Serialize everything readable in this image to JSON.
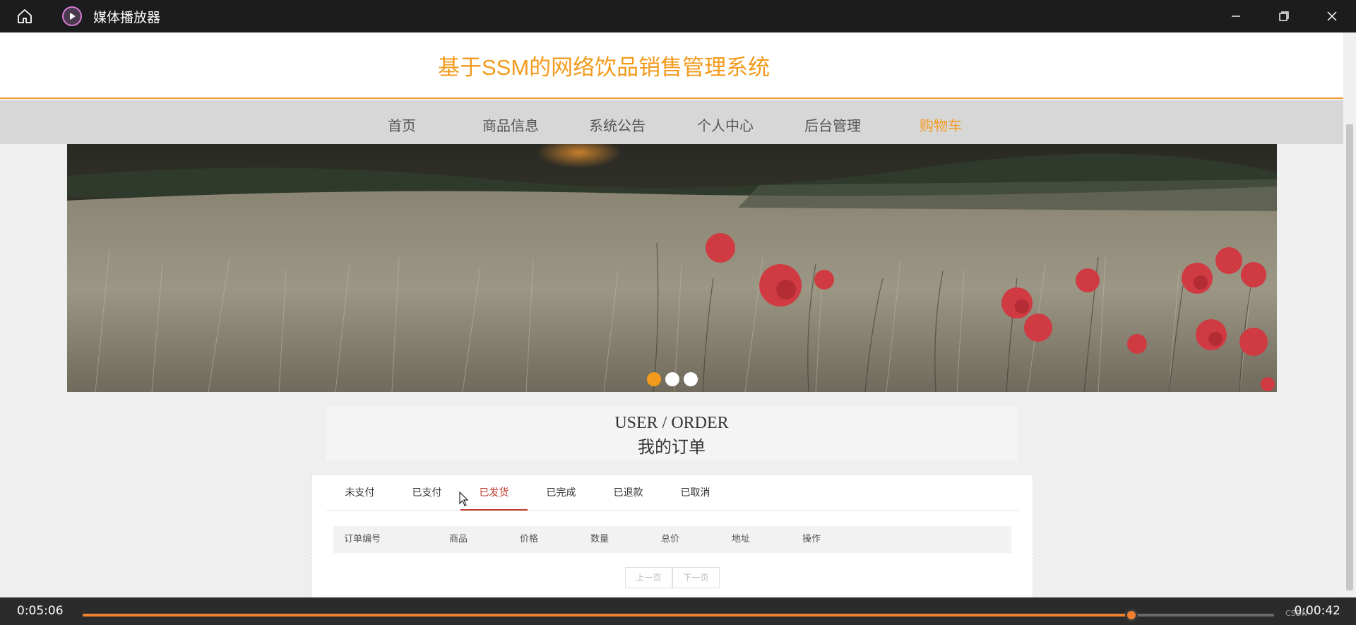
{
  "player_window": {
    "title": "媒体播放器",
    "elapsed": "0:05:06",
    "remaining": "0:00:42",
    "progress_fraction": 0.88,
    "watermark": "CSDN"
  },
  "site": {
    "title": "基于SSM的网络饮品销售管理系统",
    "accent_color": "#f39a1c"
  },
  "nav": {
    "items": [
      {
        "label": "首页"
      },
      {
        "label": "商品信息"
      },
      {
        "label": "系统公告"
      },
      {
        "label": "个人中心"
      },
      {
        "label": "后台管理"
      },
      {
        "label": "购物车"
      }
    ],
    "active_index": 5
  },
  "banner": {
    "slide_count": 3,
    "active_slide": 0
  },
  "section": {
    "title_en": "USER / ORDER",
    "title_cn": "我的订单"
  },
  "order_tabs": {
    "items": [
      {
        "label": "未支付"
      },
      {
        "label": "已支付"
      },
      {
        "label": "已发货"
      },
      {
        "label": "已完成"
      },
      {
        "label": "已退款"
      },
      {
        "label": "已取消"
      }
    ],
    "active_index": 2
  },
  "order_table": {
    "columns": [
      "订单编号",
      "商品",
      "价格",
      "数量",
      "总价",
      "地址",
      "操作"
    ]
  },
  "pager": {
    "prev": "上一页",
    "next": "下一页"
  }
}
